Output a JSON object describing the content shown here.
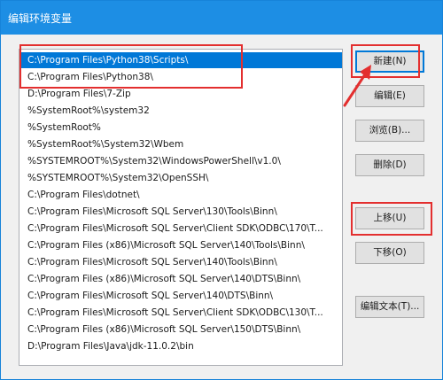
{
  "window": {
    "title": "编辑环境变量"
  },
  "list": {
    "items": [
      {
        "text": "C:\\Program Files\\Python38\\Scripts\\",
        "selected": true
      },
      {
        "text": "C:\\Program Files\\Python38\\",
        "selected": false
      },
      {
        "text": "D:\\Program Files\\7-Zip",
        "selected": false
      },
      {
        "text": "%SystemRoot%\\system32",
        "selected": false
      },
      {
        "text": "%SystemRoot%",
        "selected": false
      },
      {
        "text": "%SystemRoot%\\System32\\Wbem",
        "selected": false
      },
      {
        "text": "%SYSTEMROOT%\\System32\\WindowsPowerShell\\v1.0\\",
        "selected": false
      },
      {
        "text": "%SYSTEMROOT%\\System32\\OpenSSH\\",
        "selected": false
      },
      {
        "text": "C:\\Program Files\\dotnet\\",
        "selected": false
      },
      {
        "text": "C:\\Program Files\\Microsoft SQL Server\\130\\Tools\\Binn\\",
        "selected": false
      },
      {
        "text": "C:\\Program Files\\Microsoft SQL Server\\Client SDK\\ODBC\\170\\T...",
        "selected": false
      },
      {
        "text": "C:\\Program Files (x86)\\Microsoft SQL Server\\140\\Tools\\Binn\\",
        "selected": false
      },
      {
        "text": "C:\\Program Files\\Microsoft SQL Server\\140\\Tools\\Binn\\",
        "selected": false
      },
      {
        "text": "C:\\Program Files (x86)\\Microsoft SQL Server\\140\\DTS\\Binn\\",
        "selected": false
      },
      {
        "text": "C:\\Program Files\\Microsoft SQL Server\\140\\DTS\\Binn\\",
        "selected": false
      },
      {
        "text": "C:\\Program Files\\Microsoft SQL Server\\Client SDK\\ODBC\\130\\T...",
        "selected": false
      },
      {
        "text": "C:\\Program Files (x86)\\Microsoft SQL Server\\150\\DTS\\Binn\\",
        "selected": false
      },
      {
        "text": "D:\\Program Files\\Java\\jdk-11.0.2\\bin",
        "selected": false
      }
    ]
  },
  "buttons": {
    "new": "新建(N)",
    "edit": "编辑(E)",
    "browse": "浏览(B)...",
    "delete": "删除(D)",
    "move_up": "上移(U)",
    "move_down": "下移(O)",
    "edit_text": "编辑文本(T)..."
  },
  "colors": {
    "titlebar": "#1d8ee4",
    "selection": "#0078d7",
    "annotation": "#e32f2f"
  }
}
